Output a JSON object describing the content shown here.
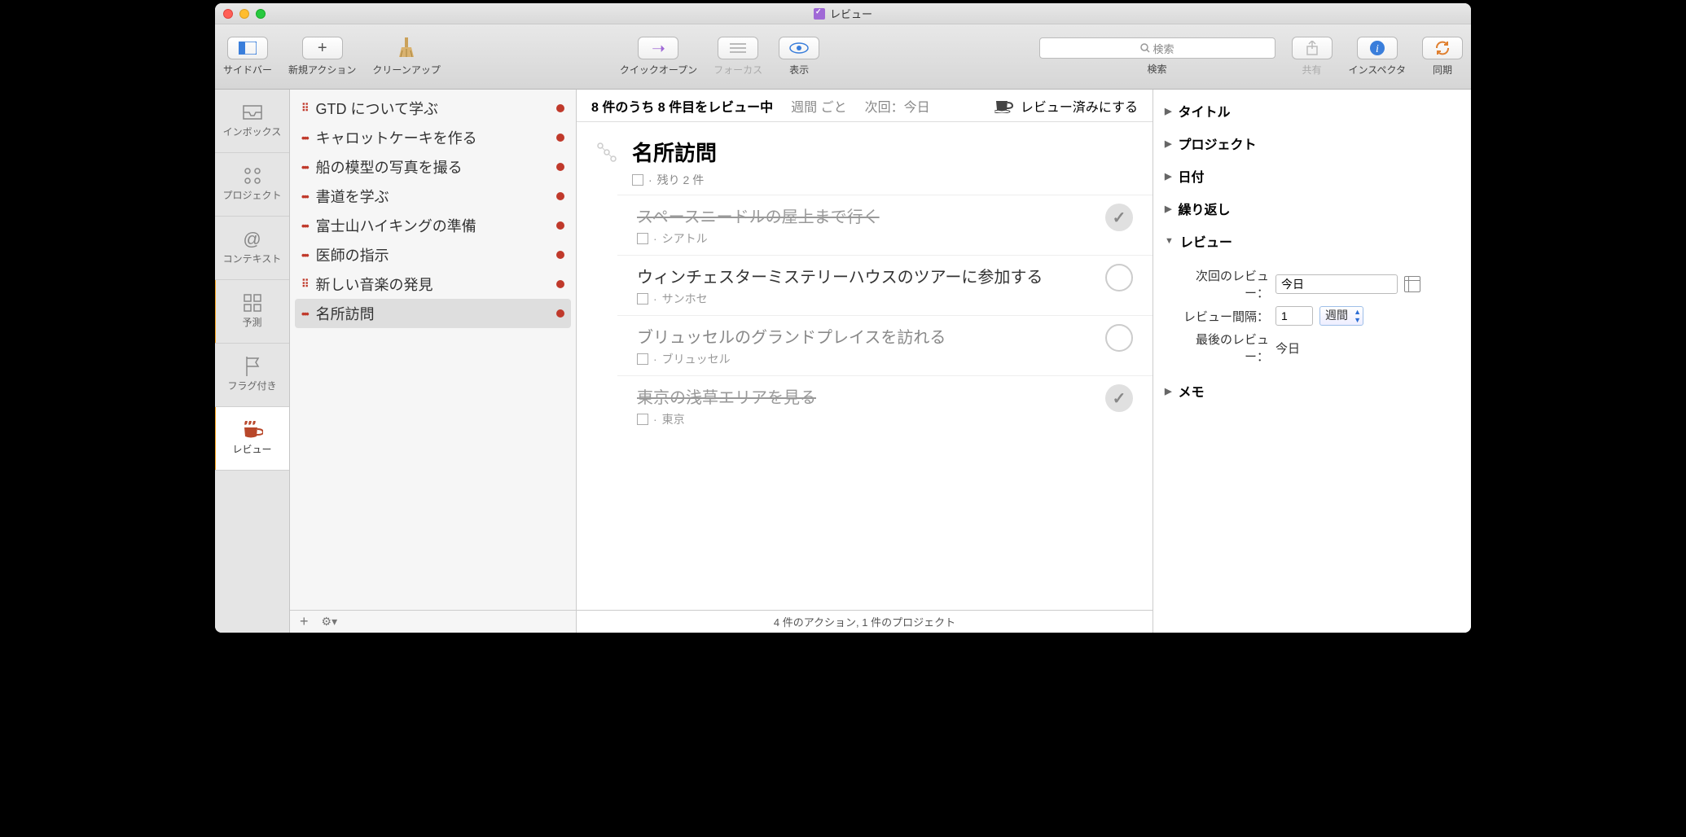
{
  "window": {
    "title": "レビュー"
  },
  "toolbar": {
    "sidebar": "サイドバー",
    "new_action": "新規アクション",
    "cleanup": "クリーンアップ",
    "quick_open": "クイックオープン",
    "focus": "フォーカス",
    "view": "表示",
    "search_placeholder": "検索",
    "search_label": "検索",
    "share": "共有",
    "inspector": "インスペクタ",
    "sync": "同期"
  },
  "perspectives": {
    "inbox": "インボックス",
    "projects": "プロジェクト",
    "contexts": "コンテキスト",
    "forecast": "予測",
    "flagged": "フラグ付き",
    "review": "レビュー"
  },
  "sidebar": {
    "items": [
      {
        "label": "GTD について学ぶ",
        "icon": "parallel"
      },
      {
        "label": "キャロットケーキを作る",
        "icon": "sequential"
      },
      {
        "label": "船の模型の写真を撮る",
        "icon": "sequential"
      },
      {
        "label": "書道を学ぶ",
        "icon": "sequential"
      },
      {
        "label": "富士山ハイキングの準備",
        "icon": "sequential"
      },
      {
        "label": "医師の指示",
        "icon": "sequential"
      },
      {
        "label": "新しい音楽の発見",
        "icon": "parallel"
      },
      {
        "label": "名所訪問",
        "icon": "sequential"
      }
    ]
  },
  "review_bar": {
    "status": "8 件のうち 8 件目をレビュー中",
    "interval": "週間 ごと",
    "next": "次回：今日",
    "mark": "レビュー済みにする"
  },
  "project": {
    "name": "名所訪問",
    "remaining": "残り 2 件",
    "tasks": [
      {
        "title": "スペースニードルの屋上まで行く",
        "sub": "シアトル",
        "done": true
      },
      {
        "title": "ウィンチェスターミステリーハウスのツアーに参加する",
        "sub": "サンホセ",
        "done": false
      },
      {
        "title": "ブリュッセルのグランドプレイスを訪れる",
        "sub": "ブリュッセル",
        "done": false
      },
      {
        "title": "東京の浅草エリアを見る",
        "sub": "東京",
        "done": true
      }
    ]
  },
  "footer": {
    "summary": "4 件のアクション, 1 件のプロジェクト"
  },
  "inspector": {
    "title": "タイトル",
    "project": "プロジェクト",
    "dates": "日付",
    "repeat": "繰り返し",
    "review": "レビュー",
    "note": "メモ",
    "next_review_label": "次回のレビュー：",
    "next_review_value": "今日",
    "interval_label": "レビュー間隔：",
    "interval_value": "1",
    "interval_unit": "週間",
    "last_review_label": "最後のレビュー：",
    "last_review_value": "今日"
  }
}
